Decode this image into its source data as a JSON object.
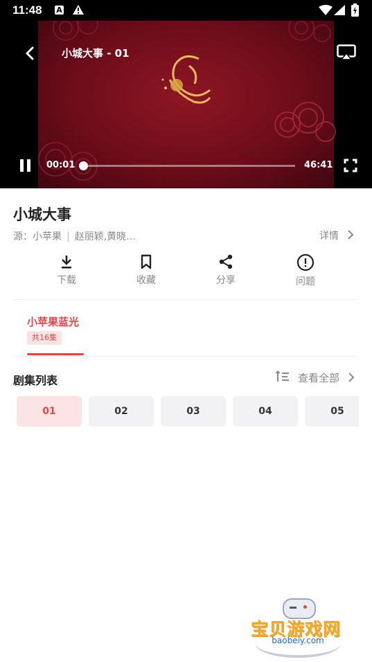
{
  "status_bar": {
    "time": "11:48",
    "notif_letter": "A"
  },
  "player": {
    "title": "小城大事 - 01",
    "current_time": "00:01",
    "duration": "46:41",
    "progress_fraction": 0.0004
  },
  "show": {
    "title": "小城大事",
    "source_label": "源：小苹果",
    "cast": "赵丽颖,黄晓…",
    "details_label": "详情"
  },
  "actions": [
    {
      "label": "下载",
      "icon": "download-icon"
    },
    {
      "label": "收藏",
      "icon": "bookmark-icon"
    },
    {
      "label": "分享",
      "icon": "share-icon"
    },
    {
      "label": "问题",
      "icon": "alert-circle-icon"
    }
  ],
  "source": {
    "name": "小苹果蓝光",
    "episode_count": "共16集"
  },
  "episodes_section": {
    "title": "剧集列表",
    "view_all": "查看全部"
  },
  "episodes": [
    "01",
    "02",
    "03",
    "04",
    "05"
  ],
  "colors": {
    "accent": "#e04848",
    "accent_light": "#fde4e4",
    "chip_bg": "#f2f2f5"
  },
  "watermark": {
    "text": "宝贝游戏网",
    "url": "baobeiy.com"
  }
}
